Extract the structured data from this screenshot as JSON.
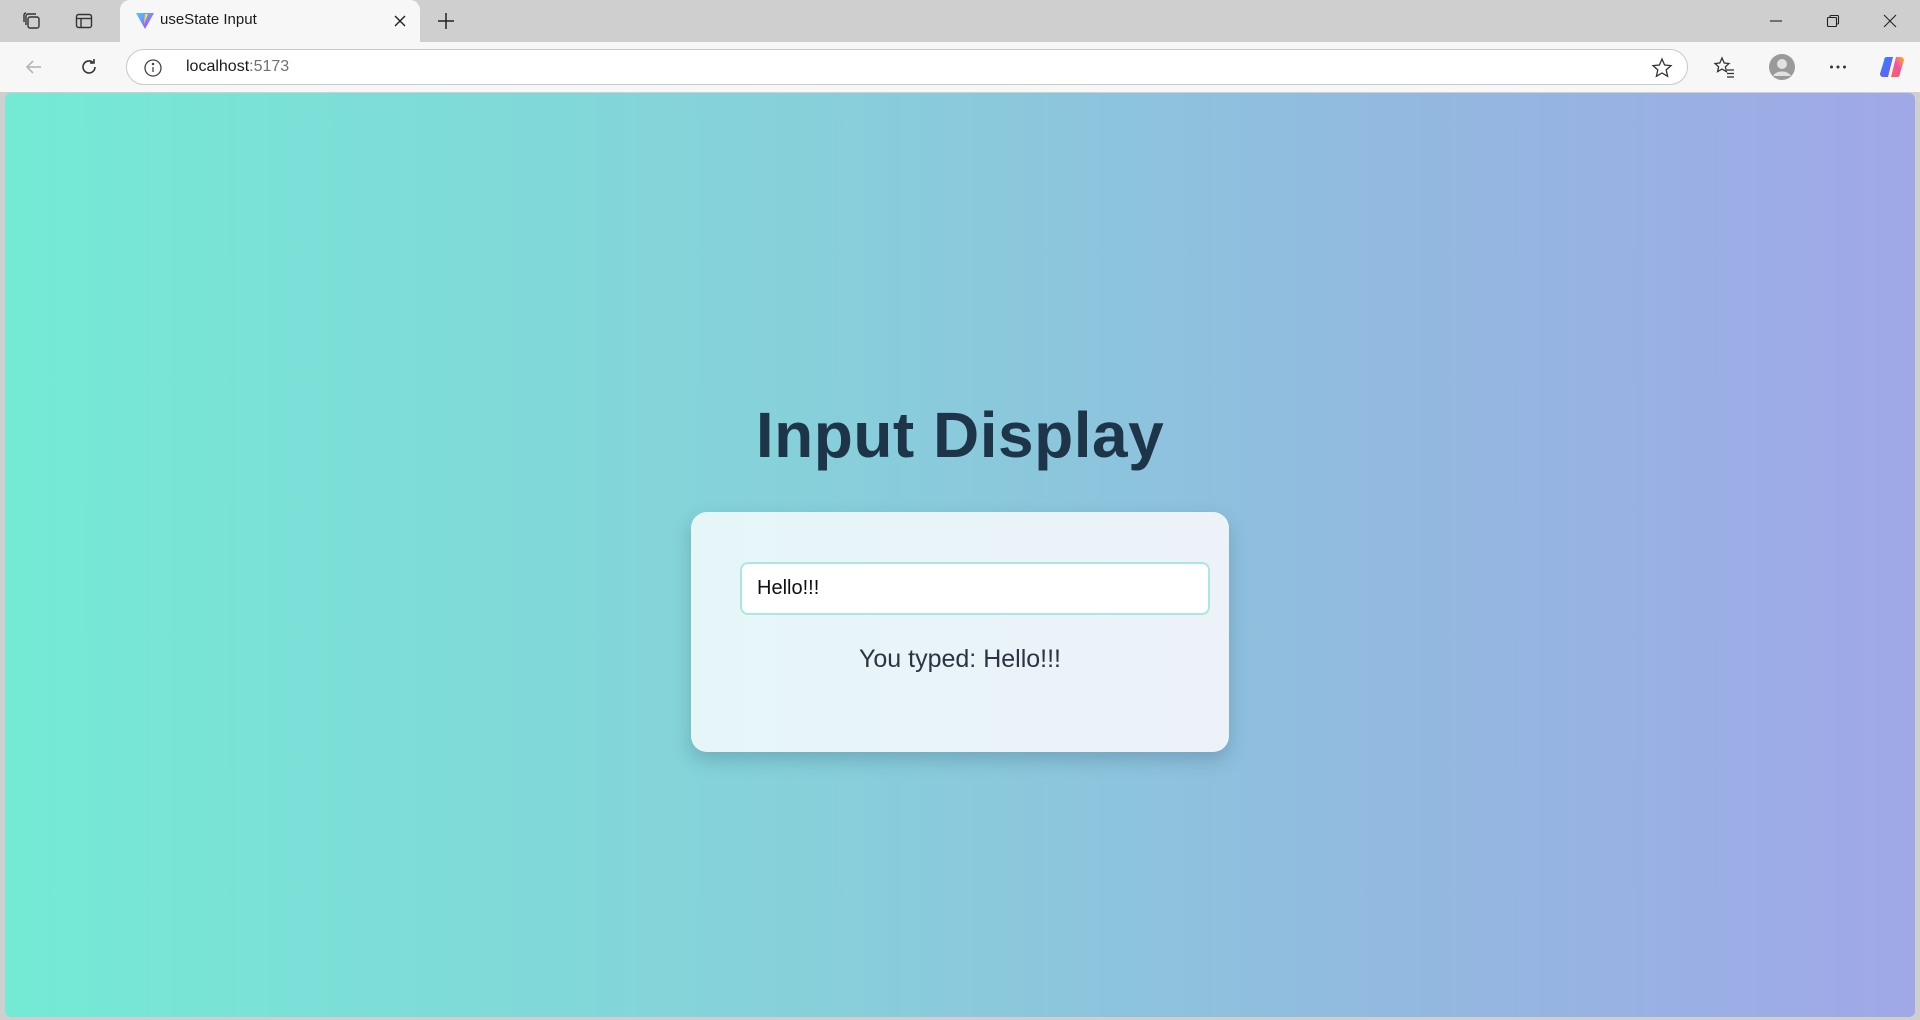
{
  "browser": {
    "tab": {
      "title": "useState Input"
    },
    "address": {
      "host": "localhost",
      "port": ":5173"
    }
  },
  "page": {
    "heading": "Input Display",
    "input": {
      "value": "Hello!!!"
    },
    "display": {
      "prefix": "You typed: ",
      "value": "Hello!!!"
    }
  },
  "colors": {
    "gradient_start": "#74ead5",
    "gradient_end": "#a0a8e8",
    "heading": "#1e3448",
    "input_border": "#a9e8e2"
  },
  "icons": [
    "workspaces-icon",
    "tab-actions-icon",
    "vite-favicon-icon",
    "close-icon",
    "plus-icon",
    "minimize-icon",
    "restore-icon",
    "window-close-icon",
    "back-arrow-icon",
    "refresh-icon",
    "info-icon",
    "star-icon",
    "favorites-icon",
    "profile-avatar-icon",
    "more-icon",
    "copilot-icon"
  ]
}
